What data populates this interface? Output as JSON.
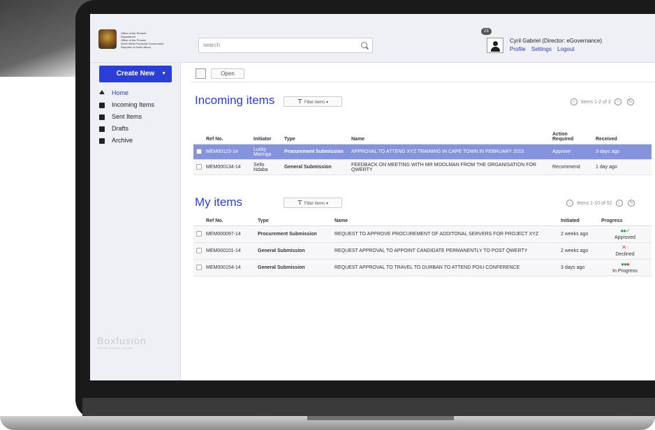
{
  "header": {
    "logo_lines": [
      "Office of the Premier",
      "Department",
      "Office of the Premier",
      "North West Provincial Government",
      "Republic of South Africa"
    ],
    "search_placeholder": "search",
    "notification_count": "23",
    "user_name": "Cyril Gabriel (Director: eGovernance)",
    "links": [
      "Profile",
      "Settings",
      "Logout"
    ]
  },
  "sidebar": {
    "create_label": "Create New",
    "items": [
      {
        "label": "Home",
        "icon": "home-icon"
      },
      {
        "label": "Incoming Items",
        "icon": "inbox-icon"
      },
      {
        "label": "Sent Items",
        "icon": "sent-icon"
      },
      {
        "label": "Drafts",
        "icon": "drafts-icon"
      },
      {
        "label": "Archive",
        "icon": "archive-icon"
      }
    ],
    "brand": "Boxfusion",
    "brand_tagline": "Process, Solutions, Software"
  },
  "toolbar": {
    "open_label": "Open"
  },
  "incoming": {
    "title": "Incoming items",
    "filter_label": "Filter items",
    "pager": "Items 1-2 of 2",
    "columns": [
      "Ref No.",
      "Initiator",
      "Type",
      "Name",
      "Action Required",
      "Received"
    ],
    "rows": [
      {
        "ref": "MEM00123-14",
        "initiator": "Lucky Maringa",
        "type": "Procurement Submission",
        "name": "APPROVAL TO ATTEND XYZ TRAINING IN CAPE TOWN IN FEBRUARY 2015",
        "action": "Approve",
        "received": "3 days ago"
      },
      {
        "ref": "MEM000134-14",
        "initiator": "Sello Ndaba",
        "type": "General Submission",
        "name": "FEEDBACK ON MEETING WITH MR MOOLMAN FROM THE ORGANISATION FOR QWERTY",
        "action": "Recommend",
        "received": "1 day ago"
      }
    ]
  },
  "myitems": {
    "title": "My items",
    "filter_label": "Filter items",
    "pager": "Items 1-10 of 52",
    "columns": [
      "Ref No.",
      "Type",
      "Name",
      "Initiated",
      "Progress"
    ],
    "rows": [
      {
        "ref": "MEM000097-14",
        "type": "Procurement Submission",
        "name": "REQUEST TO APPROVE PROCUREMENT OF ADDITONAL SERVERS FOR PROJECT XYZ",
        "initiated": "2 weeks ago",
        "status": "Approved"
      },
      {
        "ref": "MEM000101-14",
        "type": "General Submission",
        "name": "REQUEST APPROVAL TO APPOINT CANDIDATE PERMANENTLY TO POST QWERTY",
        "initiated": "2 weeks ago",
        "status": "Declined"
      },
      {
        "ref": "MEM000154-14",
        "type": "General Submission",
        "name": "REQUEST APPROVAL TO TRAVEL TO DURBAN TO ATTEND POIU CONFERENCE",
        "initiated": "3 days ago",
        "status": "In Progress"
      }
    ]
  },
  "colors": {
    "accent": "#2b3ed6",
    "selected_row": "#8593dd",
    "approved": "#2aa84a",
    "declined": "#e23a2a"
  }
}
